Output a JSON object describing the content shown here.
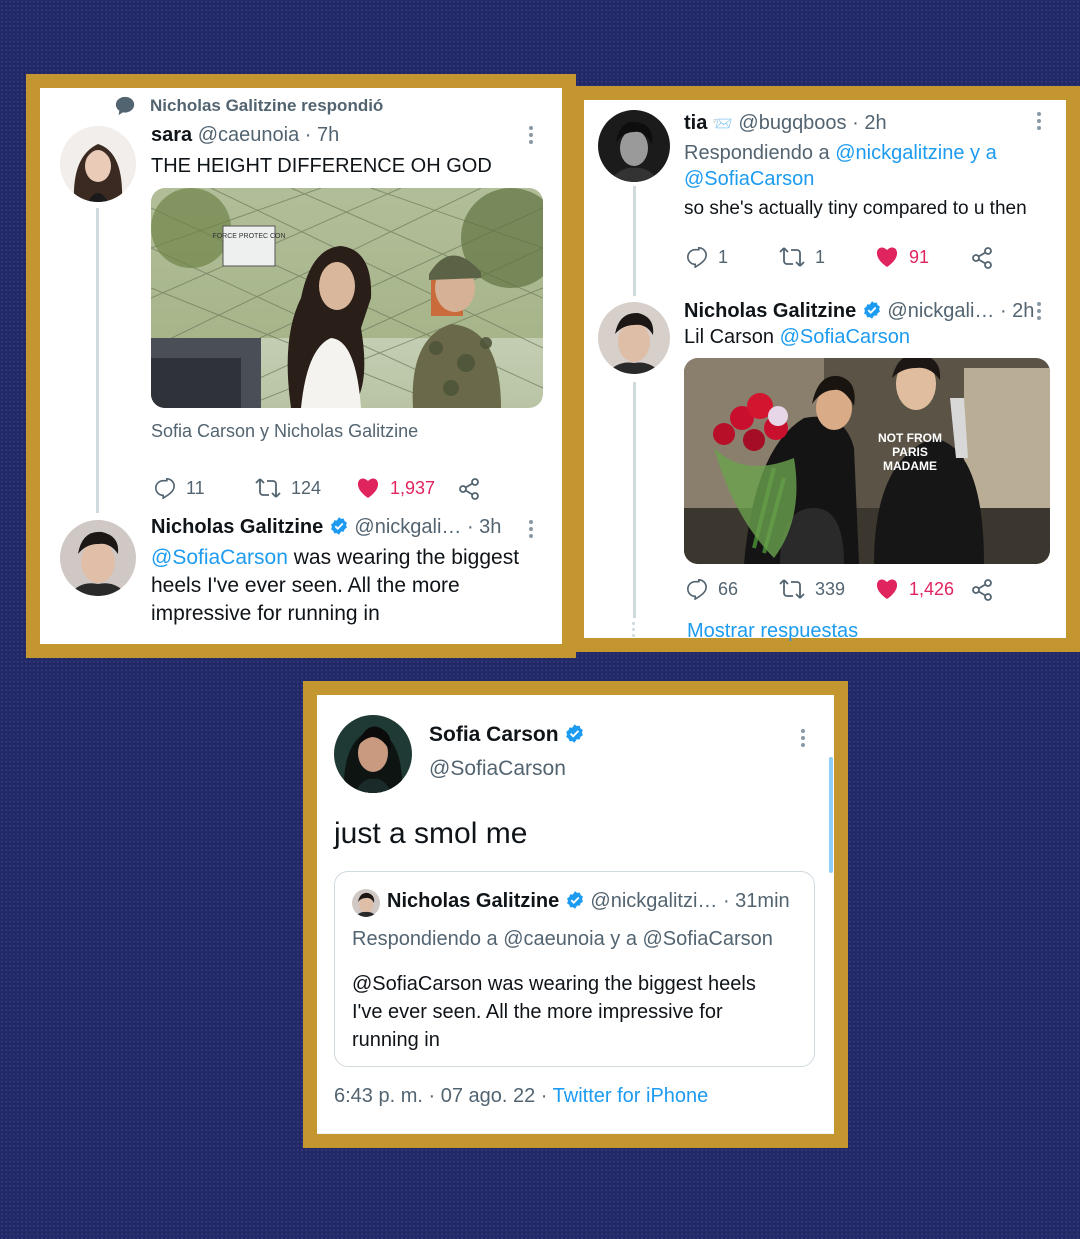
{
  "colors": {
    "background": "#232a6b",
    "frame": "#c4962f",
    "link": "#1d9bf0",
    "like": "#e0245e",
    "muted": "#536471"
  },
  "card1": {
    "social_context": "Nicholas Galitzine respondió",
    "tweet1": {
      "name": "sara",
      "handle": "@caeunoia",
      "time": "· 7h",
      "text": "THE HEIGHT DIFFERENCE OH GOD",
      "media_sign": "FORCE PROTEC CON",
      "caption": "Sofia Carson y Nicholas Galitzine",
      "replies": "11",
      "retweets": "124",
      "likes": "1,937"
    },
    "tweet2": {
      "name": "Nicholas Galitzine",
      "handle": "@nickgali…",
      "time": "· 3h",
      "mention": "@SofiaCarson",
      "text_line1": " was wearing the biggest",
      "text_line2": "heels I've ever seen. All the more",
      "text_line3": "impressive for running in"
    }
  },
  "card2": {
    "tweet1": {
      "name": "tia",
      "emoji": "📨",
      "handle": "@bugqboos",
      "time": "· 2h",
      "replying_prefix": "Respondiendo a ",
      "replying_to_line1": "@nickgalitzine y a",
      "replying_to_line2": "@SofiaCarson",
      "text": "so she's actually tiny compared to u then",
      "replies": "1",
      "retweets": "1",
      "likes": "91"
    },
    "tweet2": {
      "name": "Nicholas Galitzine",
      "handle": "@nickgali…",
      "time": "· 2h",
      "text": "Lil Carson ",
      "mention": "@SofiaCarson",
      "shirt_text": [
        "NOT FROM",
        "PARIS",
        "MADAME"
      ],
      "replies": "66",
      "retweets": "339",
      "likes": "1,426"
    },
    "show_replies": "Mostrar respuestas"
  },
  "card3": {
    "name": "Sofia Carson",
    "handle": "@SofiaCarson",
    "text": "just a smol me",
    "quote": {
      "name": "Nicholas Galitzine",
      "handle": "@nickgalitzi…",
      "time": "· 31min",
      "replying": "Respondiendo a @caeunoia y a @SofiaCarson",
      "text_line1": "@SofiaCarson was wearing the biggest heels",
      "text_line2": "I've ever seen. All the more impressive for",
      "text_line3": "running in"
    },
    "timestamp": "6:43 p. m. · 07 ago. 22 · ",
    "source": "Twitter for iPhone"
  }
}
